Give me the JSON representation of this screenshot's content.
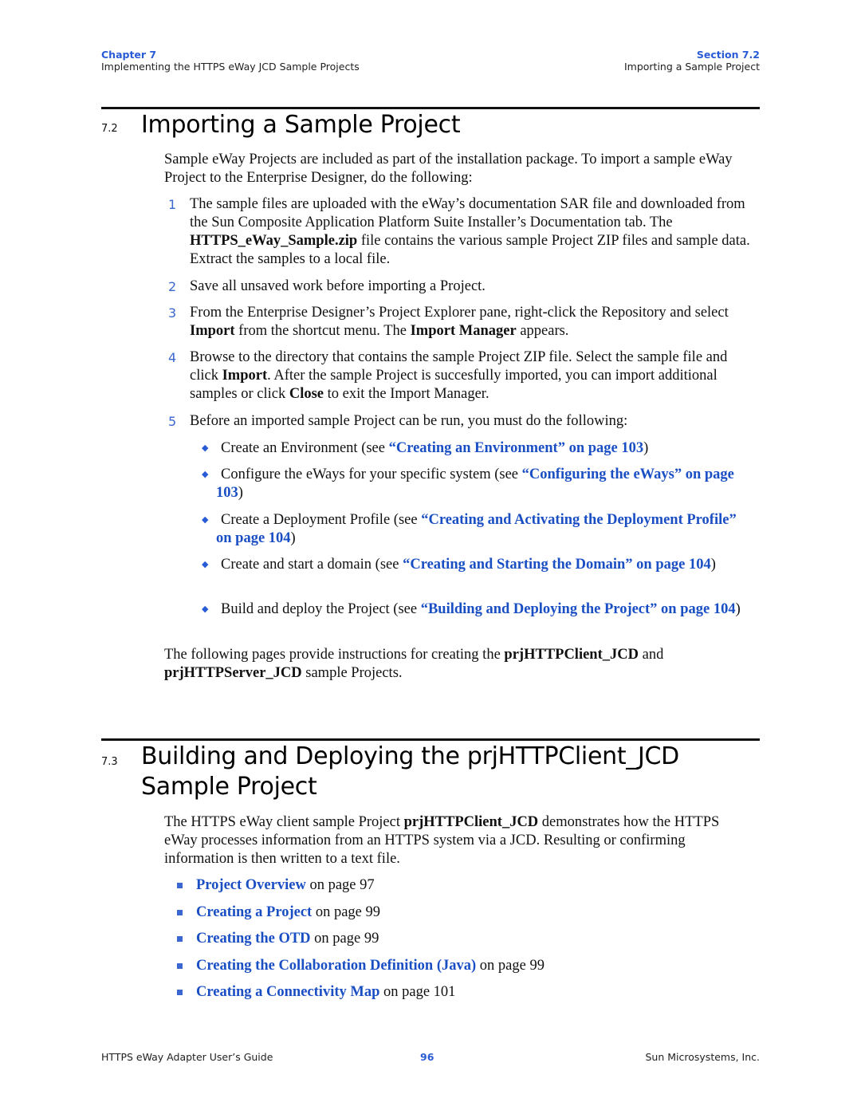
{
  "header": {
    "chapter_label": "Chapter 7",
    "chapter_title": "Implementing the HTTPS eWay JCD Sample Projects",
    "section_label": "Section 7.2",
    "section_title": "Importing a Sample Project"
  },
  "section_72": {
    "number": "7.2",
    "title": "Importing a Sample Project",
    "intro": "Sample eWay Projects are included as part of the installation package. To import a sample eWay Project to the Enterprise Designer, do the following:",
    "steps": [
      {
        "n": "1",
        "parts": [
          "The sample files are uploaded with the eWay’s documentation SAR file and downloaded from the Sun Composite Application Platform Suite Installer’s Documentation tab. The ",
          "HTTPS_eWay_Sample.zip",
          " file contains the various sample Project ZIP files and sample data. Extract the samples to a local file."
        ]
      },
      {
        "n": "2",
        "text": "Save all unsaved work before importing a Project."
      },
      {
        "n": "3",
        "parts": [
          "From the Enterprise Designer’s Project Explorer pane, right-click the Repository and select ",
          "Import",
          " from the shortcut menu. The ",
          "Import Manager",
          " appears."
        ]
      },
      {
        "n": "4",
        "parts": [
          "Browse to the directory that contains the sample Project ZIP file. Select the sample file and click ",
          "Import",
          ". After the sample Project is succesfully imported, you can import additional samples or click ",
          "Close",
          " to exit the Import Manager."
        ]
      },
      {
        "n": "5",
        "text": "Before an imported sample Project can be run, you must do the following:"
      }
    ],
    "substeps": [
      {
        "pre": "Create an Environment (see ",
        "link": "“Creating an Environment” on page 103",
        "post": ")"
      },
      {
        "pre": "Configure the eWays for your specific system (see ",
        "link": "“Configuring the eWays” on page 103",
        "post": ")"
      },
      {
        "pre": "Create a Deployment Profile (see ",
        "link": "“Creating and Activating the Deployment Profile” on page 104",
        "post": ")"
      },
      {
        "pre": "Create and start a domain (see ",
        "link": "“Creating and Starting the Domain” on page 104",
        "post": ")"
      },
      {
        "pre": "Build and deploy the Project (see ",
        "link": "“Building and Deploying the Project” on page 104",
        "post": ")"
      }
    ],
    "closing": {
      "pre": "The following pages provide instructions for creating the ",
      "b1": "prjHTTPClient_JCD",
      "mid": " and ",
      "b2": "prjHTTPServer_JCD",
      "post": " sample Projects."
    }
  },
  "section_73": {
    "number": "7.3",
    "title": "Building and Deploying the prjHTTPClient_JCD Sample Project",
    "intro": {
      "pre": "The HTTPS eWay client sample Project ",
      "bold": "prjHTTPClient_JCD",
      "post": " demonstrates how the HTTPS eWay processes information from an HTTPS system via a JCD. Resulting or confirming information is then written to a text file."
    },
    "links": [
      {
        "link": "Project Overview",
        "page": " on page 97"
      },
      {
        "link": "Creating a Project",
        "page": " on page 99"
      },
      {
        "link": "Creating the OTD",
        "page": " on page 99"
      },
      {
        "link": "Creating the Collaboration Definition (Java)",
        "page": " on page 99"
      },
      {
        "link": "Creating a Connectivity Map",
        "page": " on page 101"
      }
    ]
  },
  "footer": {
    "guide_title": "HTTPS eWay Adapter User’s Guide",
    "page_number": "96",
    "company": "Sun Microsystems, Inc."
  }
}
